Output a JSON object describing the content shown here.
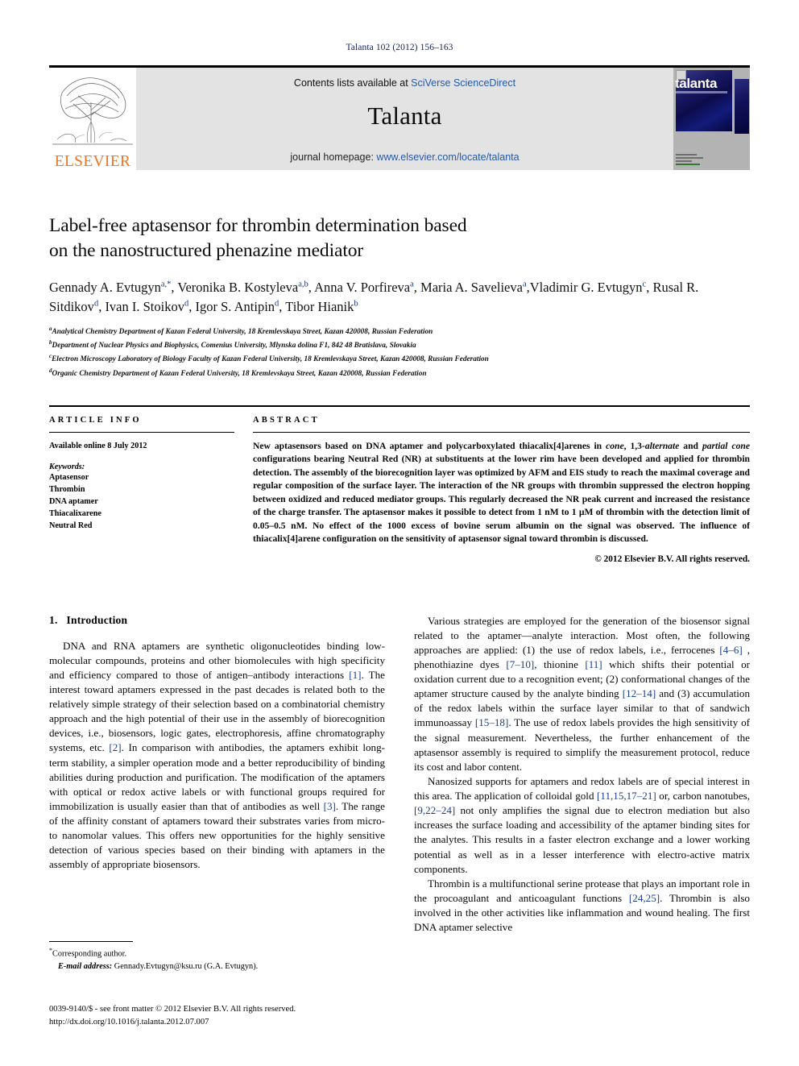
{
  "running_head": "Talanta 102 (2012) 156–163",
  "masthead": {
    "publisher_name": "ELSEVIER",
    "contents_prefix": "Contents lists available at ",
    "contents_link": "SciVerse ScienceDirect",
    "journal_name": "Talanta",
    "homepage_prefix": "journal homepage: ",
    "homepage_url": "www.elsevier.com/locate/talanta",
    "cover_title": "talanta"
  },
  "title": {
    "line1": "Label-free aptasensor for thrombin determination based",
    "line2": "on the nanostructured phenazine mediator"
  },
  "authors": [
    {
      "name": "Gennady A. Evtugyn",
      "sup": "a,*",
      "sep": ", "
    },
    {
      "name": "Veronika B. Kostyleva",
      "sup": "a,b",
      "sep": ", "
    },
    {
      "name": "Anna V. Porfireva",
      "sup": "a",
      "sep": ", "
    },
    {
      "name": "Maria A. Savelieva",
      "sup": "a",
      "sep": ","
    },
    {
      "name": "Vladimir G. Evtugyn",
      "sup": "c",
      "sep": ", "
    },
    {
      "name": "Rusal R. Sitdikov",
      "sup": "d",
      "sep": ", "
    },
    {
      "name": "Ivan I. Stoikov",
      "sup": "d",
      "sep": ", "
    },
    {
      "name": "Igor S. Antipin",
      "sup": "d",
      "sep": ", "
    },
    {
      "name": "Tibor Hianik",
      "sup": "b",
      "sep": ""
    }
  ],
  "affiliations": [
    {
      "sup": "a",
      "text": "Analytical Chemistry Department of Kazan Federal University, 18 Kremlevskaya Street, Kazan 420008, Russian Federation"
    },
    {
      "sup": "b",
      "text": "Department of Nuclear Physics and Biophysics, Comenius University, Mlynska dolina F1, 842 48 Bratislava, Slovakia"
    },
    {
      "sup": "c",
      "text": "Electron Microscopy Laboratory of Biology Faculty of Kazan Federal University, 18 Kremlevskaya Street, Kazan 420008, Russian Federation"
    },
    {
      "sup": "d",
      "text": "Organic Chemistry Department of Kazan Federal University, 18 Kremlevskaya Street, Kazan 420008, Russian Federation"
    }
  ],
  "article_info": {
    "heading": "ARTICLE INFO",
    "history": "Available online 8 July 2012",
    "keywords_label": "Keywords:",
    "keywords": [
      "Aptasensor",
      "Thrombin",
      "DNA aptamer",
      "Thiacalixarene",
      "Neutral Red"
    ]
  },
  "abstract": {
    "heading": "ABSTRACT",
    "paragraph_pre": "New aptasensors based on DNA aptamer and polycarboxylated thiacalix[4]arenes in ",
    "italic_1": "cone",
    "paragraph_mid1": ", 1,3-",
    "italic_2": "alternate",
    "paragraph_mid2": " and ",
    "italic_3": "partial cone",
    "paragraph_post": " configurations bearing Neutral Red (NR) at substituents at the lower rim have been developed and applied for thrombin detection. The assembly of the biorecognition layer was optimized by AFM and EIS study to reach the maximal coverage and regular composition of the surface layer. The interaction of the NR groups with thrombin suppressed the electron hopping between oxidized and reduced mediator groups. This regularly decreased the NR peak current and increased the resistance of the charge transfer. The aptasensor makes it possible to detect from 1 nM to 1 µM of thrombin with the detection limit of 0.05–0.5 nM. No effect of the 1000 excess of bovine serum albumin on the signal was observed. The influence of thiacalix[4]arene configuration on the sensitivity of aptasensor signal toward thrombin is discussed.",
    "copyright": "© 2012 Elsevier B.V. All rights reserved."
  },
  "introduction": {
    "number": "1.",
    "heading": "Introduction",
    "left_paragraphs": [
      "DNA and RNA aptamers are synthetic oligonucleotides binding low-molecular compounds, proteins and other biomolecules with high specificity and efficiency compared to those of antigen–antibody interactions [1]. The interest toward aptamers expressed in the past decades is related both to the relatively simple strategy of their selection based on a combinatorial chemistry approach and the high potential of their use in the assembly of biorecognition devices, i.e., biosensors, logic gates, electrophoresis, affine chromatography systems, etc. [2]. In comparison with antibodies, the aptamers exhibit long-term stability, a simpler operation mode and a better reproducibility of binding abilities during production and purification. The modification of the aptamers with optical or redox active labels or with functional groups required for immobilization is usually easier than that of antibodies as well [3]. The range of the affinity constant of aptamers toward their substrates varies from micro- to nanomolar values. This offers new opportunities for the highly sensitive detection of various species based on their binding with aptamers in the assembly of appropriate biosensors."
    ],
    "right_paragraphs": [
      "Various strategies are employed for the generation of the biosensor signal related to the aptamer—analyte interaction. Most often, the following approaches are applied: (1) the use of redox labels, i.e., ferrocenes [4–6] , phenothiazine dyes [7–10], thionine [11] which shifts their potential or oxidation current due to a recognition event; (2) conformational changes of the aptamer structure caused by the analyte binding [12–14] and (3) accumulation of the redox labels within the surface layer similar to that of sandwich immunoassay [15–18]. The use of redox labels provides the high sensitivity of the signal measurement. Nevertheless, the further enhancement of the aptasensor assembly is required to simplify the measurement protocol, reduce its cost and labor content.",
      "Nanosized supports for aptamers and redox labels are of special interest in this area. The application of colloidal gold [11,15,17–21] or, carbon nanotubes, [9,22–24] not only amplifies the signal due to electron mediation but also increases the surface loading and accessibility of the aptamer binding sites for the analytes. This results in a faster electron exchange and a lower working potential as well as in a lesser interference with electro-active matrix components.",
      "Thrombin is a multifunctional serine protease that plays an important role in the procoagulant and anticoagulant functions [24,25]. Thrombin is also involved in the other activities like inflammation and wound healing. The first DNA aptamer selective"
    ]
  },
  "footnote": {
    "corresponding": "Corresponding author.",
    "email_label": "E-mail address:",
    "email": "Gennady.Evtugyn@ksu.ru (G.A. Evtugyn)."
  },
  "imprint": {
    "line1": "0039-9140/$ - see front matter © 2012 Elsevier B.V. All rights reserved.",
    "line2": "http://dx.doi.org/10.1016/j.talanta.2012.07.007"
  },
  "colors": {
    "link_blue": "#2559a8",
    "ref_blue": "#1a3d8f",
    "runhead_navy": "#12205e",
    "elsevier_orange": "#ee7621",
    "masthead_gray": "#e3e3e3"
  }
}
